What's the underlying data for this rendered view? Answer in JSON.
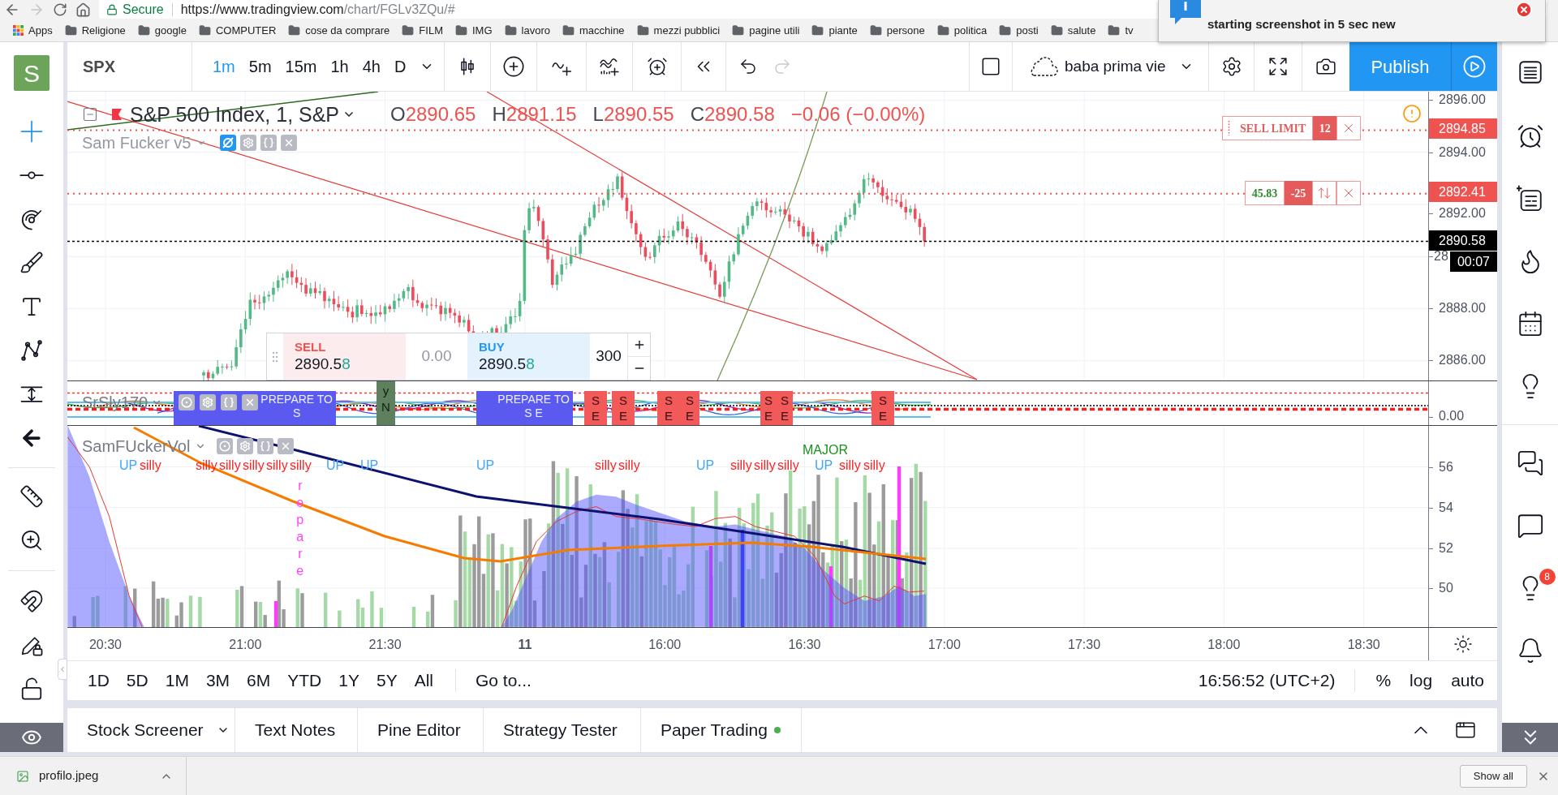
{
  "browser": {
    "secure": "Secure",
    "url_host": "https://www.tradingview.com",
    "url_path": "/chart/FGLv3ZQu/#",
    "forward_disabled": true
  },
  "bookmarks": [
    {
      "kind": "apps",
      "label": "Apps"
    },
    {
      "kind": "folder",
      "label": "Religione"
    },
    {
      "kind": "folder",
      "label": "google"
    },
    {
      "kind": "folder",
      "label": "COMPUTER"
    },
    {
      "kind": "folder",
      "label": "cose da comprare"
    },
    {
      "kind": "folder",
      "label": "FILM"
    },
    {
      "kind": "folder",
      "label": "IMG"
    },
    {
      "kind": "folder",
      "label": "lavoro"
    },
    {
      "kind": "folder",
      "label": "macchine"
    },
    {
      "kind": "folder",
      "label": "mezzi pubblici"
    },
    {
      "kind": "folder",
      "label": "pagine utili"
    },
    {
      "kind": "folder",
      "label": "piante"
    },
    {
      "kind": "folder",
      "label": "persone"
    },
    {
      "kind": "folder",
      "label": "politica"
    },
    {
      "kind": "folder",
      "label": "posti"
    },
    {
      "kind": "folder",
      "label": "salute"
    },
    {
      "kind": "folder",
      "label": "tv"
    }
  ],
  "notification": {
    "text": "starting screenshot in 5 sec new"
  },
  "header": {
    "avatar": "S",
    "symbol": "SPX",
    "intervals": [
      {
        "label": "1m",
        "selected": true
      },
      {
        "label": "5m",
        "selected": false
      },
      {
        "label": "15m",
        "selected": false
      },
      {
        "label": "1h",
        "selected": false
      },
      {
        "label": "4h",
        "selected": false
      },
      {
        "label": "D",
        "selected": false
      }
    ],
    "redo_disabled": true,
    "layout_name": "baba prima vie",
    "publish": "Publish"
  },
  "drawing_tools": [
    {
      "selected": true
    },
    {
      "selected": false
    },
    {
      "selected": false
    },
    {
      "selected": false
    },
    {
      "selected": false
    },
    {
      "selected": false
    },
    {
      "selected": false
    },
    {
      "selected": false
    },
    {
      "selected": false
    },
    {
      "selected": false
    },
    {
      "selected": false
    },
    {
      "selected": false
    },
    {
      "selected": false
    }
  ],
  "right_sidebar": {
    "ideas_badge": "8"
  },
  "main_pane": {
    "legend": {
      "title": "S&P 500 Index, 1, S&P",
      "ohlc": [
        {
          "label": "O",
          "value": "2890.65"
        },
        {
          "label": "H",
          "value": "2891.15"
        },
        {
          "label": "L",
          "value": "2890.55"
        },
        {
          "label": "C",
          "value": "2890.58"
        }
      ],
      "change": "−0.06 (−0.00%)"
    },
    "indicator": {
      "name": "Sam Fucker v5",
      "hidden": true
    },
    "orders": [
      {
        "kind": "limit",
        "label": "SELL LIMIT",
        "quantity": "12"
      },
      {
        "kind": "position",
        "pnl": "45.83",
        "quantity": "-25"
      }
    ],
    "trade_widget": {
      "sell_label": "SELL",
      "sell_price": "2890.5",
      "sell_pip": "8",
      "spread": "0.00",
      "buy_label": "BUY",
      "buy_price": "2890.5",
      "buy_pip": "8",
      "quantity": "300"
    },
    "price_labels": [
      "2896.00",
      "2894.00",
      "2892.00",
      "28",
      "2888.00",
      "2886.00"
    ],
    "price_tags": [
      {
        "kind": "order",
        "text": "2894.85"
      },
      {
        "kind": "order",
        "text": "2892.41"
      },
      {
        "kind": "last",
        "text": "2890.58"
      },
      {
        "kind": "countdown",
        "text": "00:07"
      }
    ]
  },
  "oscillator_pane": {
    "name": "SrSly170",
    "axis_label": "0.00",
    "signals": [
      {
        "kind": "prepare",
        "title": "PREPARE TO",
        "sub": "S"
      },
      {
        "kind": "confirm",
        "text": "yN"
      },
      {
        "kind": "prepare",
        "title": "PREPARE TO",
        "sub": "S E"
      },
      {
        "kind": "sell",
        "text": "SE"
      },
      {
        "kind": "sell",
        "text": "SE"
      },
      {
        "kind": "sell",
        "text": "SE"
      },
      {
        "kind": "sell",
        "text": "SE"
      },
      {
        "kind": "sell",
        "text": "SE"
      },
      {
        "kind": "sell",
        "text": "SE"
      },
      {
        "kind": "sell",
        "text": "SE"
      }
    ]
  },
  "volume_pane": {
    "name": "SamFUckerVol",
    "labels": [
      {
        "kind": "up",
        "text": "UP"
      },
      {
        "kind": "silly",
        "text": "silly"
      },
      {
        "kind": "silly",
        "text": "silly"
      },
      {
        "kind": "silly",
        "text": "silly"
      },
      {
        "kind": "silly",
        "text": "silly"
      },
      {
        "kind": "silly",
        "text": "silly"
      },
      {
        "kind": "silly",
        "text": "silly"
      },
      {
        "kind": "up",
        "text": "UP"
      },
      {
        "kind": "up",
        "text": "UP"
      },
      {
        "kind": "up",
        "text": "UP"
      },
      {
        "kind": "silly",
        "text": "silly"
      },
      {
        "kind": "silly",
        "text": "silly"
      },
      {
        "kind": "up",
        "text": "UP"
      },
      {
        "kind": "silly",
        "text": "silly"
      },
      {
        "kind": "silly",
        "text": "silly"
      },
      {
        "kind": "silly",
        "text": "silly"
      },
      {
        "kind": "major",
        "text": "MAJOR"
      },
      {
        "kind": "up",
        "text": "UP"
      },
      {
        "kind": "silly",
        "text": "silly"
      },
      {
        "kind": "silly",
        "text": "silly"
      }
    ],
    "vertical_label": "repare",
    "axis_labels": [
      "56",
      "54",
      "52",
      "50"
    ]
  },
  "time_axis": [
    {
      "kind": "time",
      "text": "20:30"
    },
    {
      "kind": "time",
      "text": "21:00"
    },
    {
      "kind": "time",
      "text": "21:30"
    },
    {
      "kind": "day",
      "text": "11"
    },
    {
      "kind": "time",
      "text": "16:00"
    },
    {
      "kind": "time",
      "text": "16:30"
    },
    {
      "kind": "time",
      "text": "17:00"
    },
    {
      "kind": "time",
      "text": "17:30"
    },
    {
      "kind": "time",
      "text": "18:00"
    },
    {
      "kind": "time",
      "text": "18:30"
    }
  ],
  "range_bar": {
    "ranges": [
      "1D",
      "5D",
      "1M",
      "3M",
      "6M",
      "YTD",
      "1Y",
      "5Y",
      "All"
    ],
    "goto": "Go to...",
    "clock": "16:56:52 (UTC+2)",
    "scales": [
      "%",
      "log",
      "auto"
    ]
  },
  "bottom_tabs": [
    {
      "label": "Stock Screener",
      "dropdown": true,
      "status_dot": false
    },
    {
      "label": "Text Notes",
      "dropdown": false,
      "status_dot": false
    },
    {
      "label": "Pine Editor",
      "dropdown": false,
      "status_dot": false
    },
    {
      "label": "Strategy Tester",
      "dropdown": false,
      "status_dot": false
    },
    {
      "label": "Paper Trading",
      "dropdown": false,
      "status_dot": true
    }
  ],
  "download_bar": {
    "file": "profilo.jpeg",
    "show_all": "Show all"
  }
}
